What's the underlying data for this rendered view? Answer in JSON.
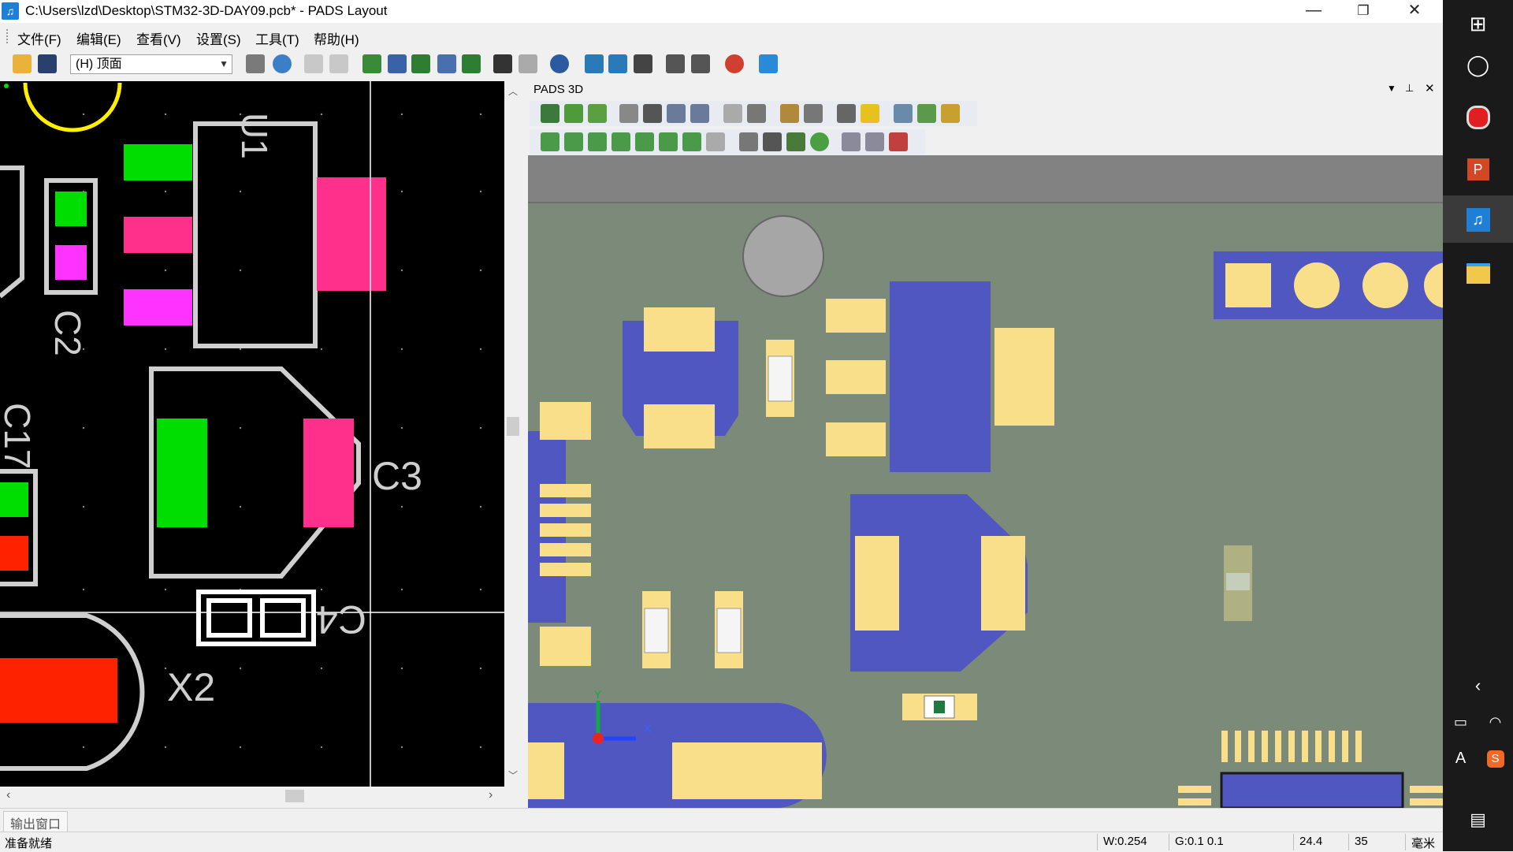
{
  "window": {
    "title": "C:\\Users\\lzd\\Desktop\\STM32-3D-DAY09.pcb* - PADS Layout",
    "minimize_glyph": "—",
    "restore_glyph": "❐",
    "close_glyph": "✕"
  },
  "menu": {
    "items": [
      "文件(F)",
      "编辑(E)",
      "查看(V)",
      "设置(S)",
      "工具(T)",
      "帮助(H)"
    ]
  },
  "toolbar": {
    "layer_value": "(H) 顶面"
  },
  "pcb2d": {
    "labels": [
      "U1",
      "C2",
      "C17",
      "C3",
      "C4",
      "X2"
    ]
  },
  "panel3d": {
    "title": "PADS 3D",
    "axis_x": "X",
    "axis_y": "Y"
  },
  "output": {
    "tab_label": "输出窗口"
  },
  "status": {
    "ready": "准备就绪",
    "width": "W:0.254",
    "grid": "G:0.1 0.1",
    "x": "24.4",
    "y": "35",
    "unit": "毫米"
  },
  "colors": {
    "board": "#7c8a7a",
    "copper_blue": "#5057c1",
    "pad_yellow": "#f9df8a",
    "pcb_bg": "#000000",
    "pad_green": "#00dd00",
    "pad_pink": "#ff2f8c",
    "pad_magenta": "#ff33ff",
    "pad_red": "#ff2200"
  }
}
